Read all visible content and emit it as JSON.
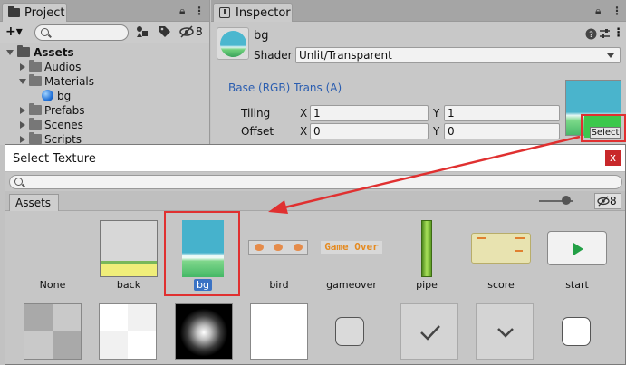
{
  "project": {
    "tab_label": "Project",
    "add_label": "+▾",
    "hidden_count": "8",
    "tree": [
      {
        "label": "Assets",
        "bold": true
      },
      {
        "label": "Audios"
      },
      {
        "label": "Materials"
      },
      {
        "label": "bg"
      },
      {
        "label": "Prefabs"
      },
      {
        "label": "Scenes"
      },
      {
        "label": "Scripts"
      }
    ]
  },
  "inspector": {
    "tab_label": "Inspector",
    "material_name": "bg",
    "shader_label": "Shader",
    "shader_value": "Unlit/Transparent",
    "property_label": "Base (RGB) Trans (A)",
    "tiling_label": "Tiling",
    "offset_label": "Offset",
    "x_label": "X",
    "y_label": "Y",
    "tiling_x": "1",
    "tiling_y": "1",
    "offset_x": "0",
    "offset_y": "0",
    "select_label": "Select"
  },
  "dialog": {
    "title": "Select Texture",
    "close_label": "x",
    "tab_label": "Assets",
    "hidden_count": "8",
    "items": [
      {
        "label": "None"
      },
      {
        "label": "back"
      },
      {
        "label": "bg",
        "selected": true
      },
      {
        "label": "bird"
      },
      {
        "label": "gameover"
      },
      {
        "label": "pipe"
      },
      {
        "label": "score"
      },
      {
        "label": "start"
      }
    ],
    "gameover_text": "Game Over"
  },
  "colors": {
    "highlight_red": "#e03030",
    "selection_blue": "#3a72c4",
    "sky": "#4ab4cc",
    "grass": "#48b86a"
  }
}
